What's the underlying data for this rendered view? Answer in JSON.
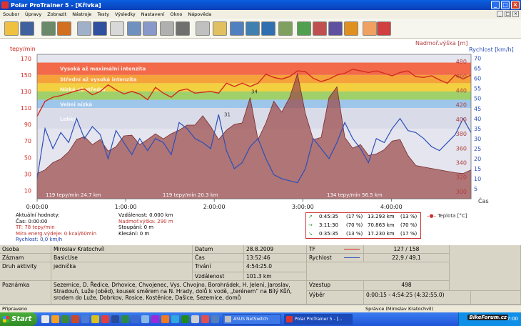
{
  "window": {
    "title": "Polar ProTrainer 5 - [Křivka]",
    "buttons": [
      "_",
      "□",
      "×"
    ]
  },
  "menu": [
    "Soubor",
    "Úpravy",
    "Zobrazit",
    "Nástroje",
    "Testy",
    "Výsledky",
    "Nastavení",
    "Okno",
    "Nápověda"
  ],
  "mdi_buttons": [
    "_",
    "□",
    "×"
  ],
  "toolbar_icons": [
    "folder-open-icon",
    "save-icon",
    "person-sync-icon",
    "person-icon",
    "calendar-icon",
    "diary-icon",
    "fitness-test-icon",
    "bar-chart-icon",
    "bar-chart-2-icon",
    "compare-icon",
    "table-icon",
    "zoom-icon",
    "marker-icon",
    "route-icon",
    "transfer-icon",
    "rotate-icon",
    "pulse-icon",
    "zones-chart-icon",
    "zones-chart-2-icon",
    "zones-chart-3-icon",
    "zones-chart-4-icon",
    "weather-icon",
    "heart-rate-icon"
  ],
  "graph": {
    "left_axis_title": "tepy/min",
    "right_axis_title_1": "Nadmoř.výška [m]",
    "right_axis_title_2": "Rychlost [km/h]",
    "x_axis_title": "Čas",
    "zone_labels": [
      "Vysoká až maximální intenzita",
      "Střední až vysoká intenzita",
      "Nízká až střední",
      "Velmi nízká",
      "Lehký"
    ],
    "bottom_labels": [
      "119 tepy/min 24.7 km",
      "119 tepy/min 20.3 km",
      "134 tepy/min 56.5 km"
    ],
    "marker_labels": [
      "31",
      "34"
    ]
  },
  "chart_data": {
    "type": "line",
    "xlabel": "Čas",
    "ylabel": "tepy/min",
    "x_ticks": [
      "0:00:00",
      "1:00:00",
      "2:00:00",
      "3:00:00",
      "4:00:00"
    ],
    "hr_ticks": [
      170,
      150,
      130,
      110,
      90,
      70,
      50,
      30,
      10
    ],
    "alt_ticks": [
      480,
      460,
      440,
      420,
      400,
      380,
      360,
      340,
      320,
      300
    ],
    "speed_ticks": [
      70,
      65,
      60,
      55,
      50,
      45,
      40,
      35,
      30,
      25,
      20,
      15,
      10,
      5
    ],
    "hr_range": [
      0,
      175
    ],
    "alt_range": [
      290,
      490
    ],
    "speed_range": [
      0,
      72
    ],
    "zones": [
      {
        "from": 150,
        "to": 165,
        "color": "#f26a4a"
      },
      {
        "from": 140,
        "to": 150,
        "color": "#f5a23a"
      },
      {
        "from": 130,
        "to": 140,
        "color": "#f3d040"
      },
      {
        "from": 120,
        "to": 130,
        "color": "#9fd06a"
      },
      {
        "from": 110,
        "to": 120,
        "color": "#9ec6ea"
      },
      {
        "from": 85,
        "to": 110,
        "color": "#d9dbe8"
      }
    ],
    "series": [
      {
        "name": "TF",
        "color": "#d32a1f",
        "values": [
          100,
          118,
          123,
          125,
          128,
          131,
          133,
          126,
          130,
          138,
          132,
          127,
          130,
          127,
          120,
          135,
          128,
          123,
          131,
          133,
          128,
          129,
          130,
          128,
          140,
          136,
          140,
          136,
          140,
          151,
          147,
          145,
          148,
          155,
          154,
          146,
          142,
          145,
          150,
          152,
          157,
          155,
          153,
          155,
          152,
          149,
          153,
          155,
          148,
          147,
          149,
          144,
          140,
          150,
          145,
          150
        ]
      },
      {
        "name": "Rychlost",
        "color": "#2c4fb8",
        "values": [
          10,
          35,
          25,
          33,
          28,
          40,
          30,
          36,
          32,
          20,
          34,
          28,
          22,
          30,
          24,
          30,
          28,
          22,
          38,
          35,
          30,
          28,
          25,
          42,
          24,
          15,
          18,
          26,
          30,
          20,
          12,
          10,
          9,
          8,
          15,
          30,
          25,
          20,
          28,
          38,
          30,
          25,
          18,
          30,
          28,
          35,
          40,
          34,
          33,
          30,
          26,
          24,
          28,
          32,
          40,
          33
        ]
      },
      {
        "name": "Nadmoř.výška",
        "color": "#b06a6a",
        "values": [
          325,
          330,
          340,
          345,
          355,
          372,
          376,
          365,
          372,
          356,
          362,
          377,
          378,
          365,
          372,
          380,
          373,
          380,
          385,
          392,
          392,
          405,
          390,
          372,
          385,
          393,
          395,
          430,
          372,
          395,
          425,
          410,
          430,
          463,
          408,
          372,
          375,
          430,
          445,
          375,
          360,
          365,
          350,
          352,
          358,
          370,
          372,
          350,
          336,
          334,
          332,
          330,
          328,
          326,
          325,
          330
        ]
      },
      {
        "name": "Teplota",
        "color": "#c33",
        "values": []
      }
    ]
  },
  "current_values": {
    "heading": "Aktuální hodnoty:",
    "time": "Čas: 0:00:00",
    "tf": "TF: 78 tepy/min",
    "energy": "Míra energ.výdeje: 0 kcal/60min",
    "speed": "Rychlost: 0,0 km/h",
    "distance": "Vzdálenost: 0.000 km",
    "altitude": "Nadmoř.výška: 290 m",
    "ascent": "Stoupání: 0 m",
    "descent": "Klesání: 0 m"
  },
  "zone_summary": [
    {
      "time": "0:45:35",
      "time_pct": "(17 %)",
      "dist": "13.293 km",
      "dist_pct": "(13 %)"
    },
    {
      "time": "3:11:30",
      "time_pct": "(70 %)",
      "dist": "70.863 km",
      "dist_pct": "(70 %)"
    },
    {
      "time": "0:35:35",
      "time_pct": "(13 %)",
      "dist": "17.230 km",
      "dist_pct": "(17 %)"
    }
  ],
  "legend_temp": "Teplota [°C]",
  "details": {
    "osoba_label": "Osoba",
    "osoba_value": "Miroslav Kratochvíl",
    "zaznam_label": "Záznam",
    "zaznam_value": "BasicUse",
    "druh_label": "Druh aktivity",
    "druh_value": "jednička",
    "poznamka_label": "Poznámka",
    "poznamka_value": "Sezemice, D. Ředice, Drhovice, Chvojenec, Vys. Chvojno, Borohrádek, H. Jelení, Jaroslav, Stradouň, Luže (oběd), kousek směrem na N. Hrady, dolů k vodě, „terénem“ na Bílý Kůň, srodem do Luže, Dobrkov, Rosice, Kostěnice, Dašice, Sezemice, domů",
    "datum_label": "Datum",
    "datum_value": "28.8.2009",
    "cas_label": "Čas",
    "cas_value": "13:52:46",
    "trvani_label": "Trvání",
    "trvani_value": "4:54:25.0",
    "vzdalenost_label": "Vzdálenost",
    "vzdalenost_value": "101.3 km",
    "tf_label": "TF",
    "tf_value": "127 / 158",
    "rychlost_label": "Rychlost",
    "rychlost_value": "22,9 / 49,1",
    "vzestup_label": "Vzestup",
    "vzestup_value": "498",
    "vyber_label": "Výběr",
    "vyber_value": "0:00:15 - 4:54:25 (4:32:55.0)"
  },
  "status": {
    "left": "Připraveno",
    "right": "Správce (Miroslav Kratochvil)"
  },
  "taskbar": {
    "start": "Start",
    "tasks": [
      "ASUS NetSwitch",
      "Polar ProTrainer 5 - [..."
    ],
    "watermark": "BikeForum.cz",
    "clock": "7:00"
  }
}
